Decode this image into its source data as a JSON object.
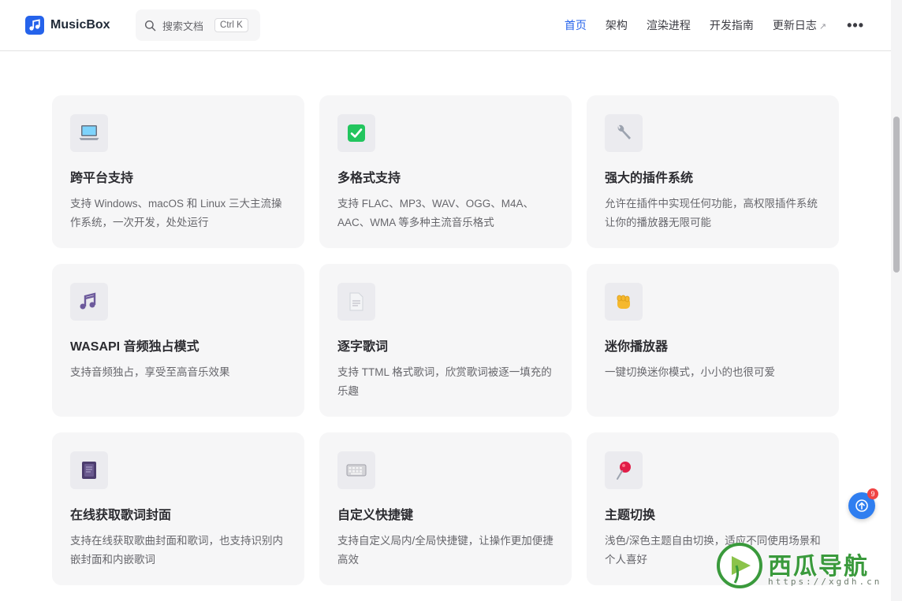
{
  "brand": {
    "name": "MusicBox",
    "logo": "music-note-icon",
    "color": "#2563eb"
  },
  "search": {
    "placeholder": "搜索文档",
    "shortcut": "Ctrl K"
  },
  "nav": {
    "items": [
      {
        "label": "首页",
        "active": true
      },
      {
        "label": "架构",
        "active": false
      },
      {
        "label": "渲染进程",
        "active": false
      },
      {
        "label": "开发指南",
        "active": false
      },
      {
        "label": "更新日志",
        "active": false,
        "external": true
      }
    ],
    "more_icon": "more-horizontal-icon",
    "external_glyph": "↗",
    "more_glyph": "•••"
  },
  "features": [
    {
      "icon": "laptop-icon",
      "title": "跨平台支持",
      "desc": "支持 Windows、macOS 和 Linux 三大主流操作系统，一次开发，处处运行"
    },
    {
      "icon": "check-icon",
      "title": "多格式支持",
      "desc": "支持 FLAC、MP3、WAV、OGG、M4A、AAC、WMA 等多种主流音乐格式"
    },
    {
      "icon": "wrench-icon",
      "title": "强大的插件系统",
      "desc": "允许在插件中实现任何功能，高权限插件系统让你的播放器无限可能"
    },
    {
      "icon": "music-notes-icon",
      "title": "WASAPI 音频独占模式",
      "desc": "支持音频独占，享受至高音乐效果"
    },
    {
      "icon": "document-icon",
      "title": "逐字歌词",
      "desc": "支持 TTML 格式歌词，欣赏歌词被逐一填充的乐趣"
    },
    {
      "icon": "fist-icon",
      "title": "迷你播放器",
      "desc": "一键切换迷你模式，小小的也很可爱"
    },
    {
      "icon": "notebook-icon",
      "title": "在线获取歌词封面",
      "desc": "支持在线获取歌曲封面和歌词，也支持识别内嵌封面和内嵌歌词"
    },
    {
      "icon": "keyboard-icon",
      "title": "自定义快捷键",
      "desc": "支持自定义局内/全局快捷键，让操作更加便捷高效"
    },
    {
      "icon": "pushpin-icon",
      "title": "主题切换",
      "desc": "浅色/深色主题自由切换，适应不同使用场景和个人喜好"
    }
  ],
  "widgets": {
    "notification_count": "9",
    "watermark_title": "西瓜导航",
    "watermark_url": "https://xgdh.cn"
  }
}
